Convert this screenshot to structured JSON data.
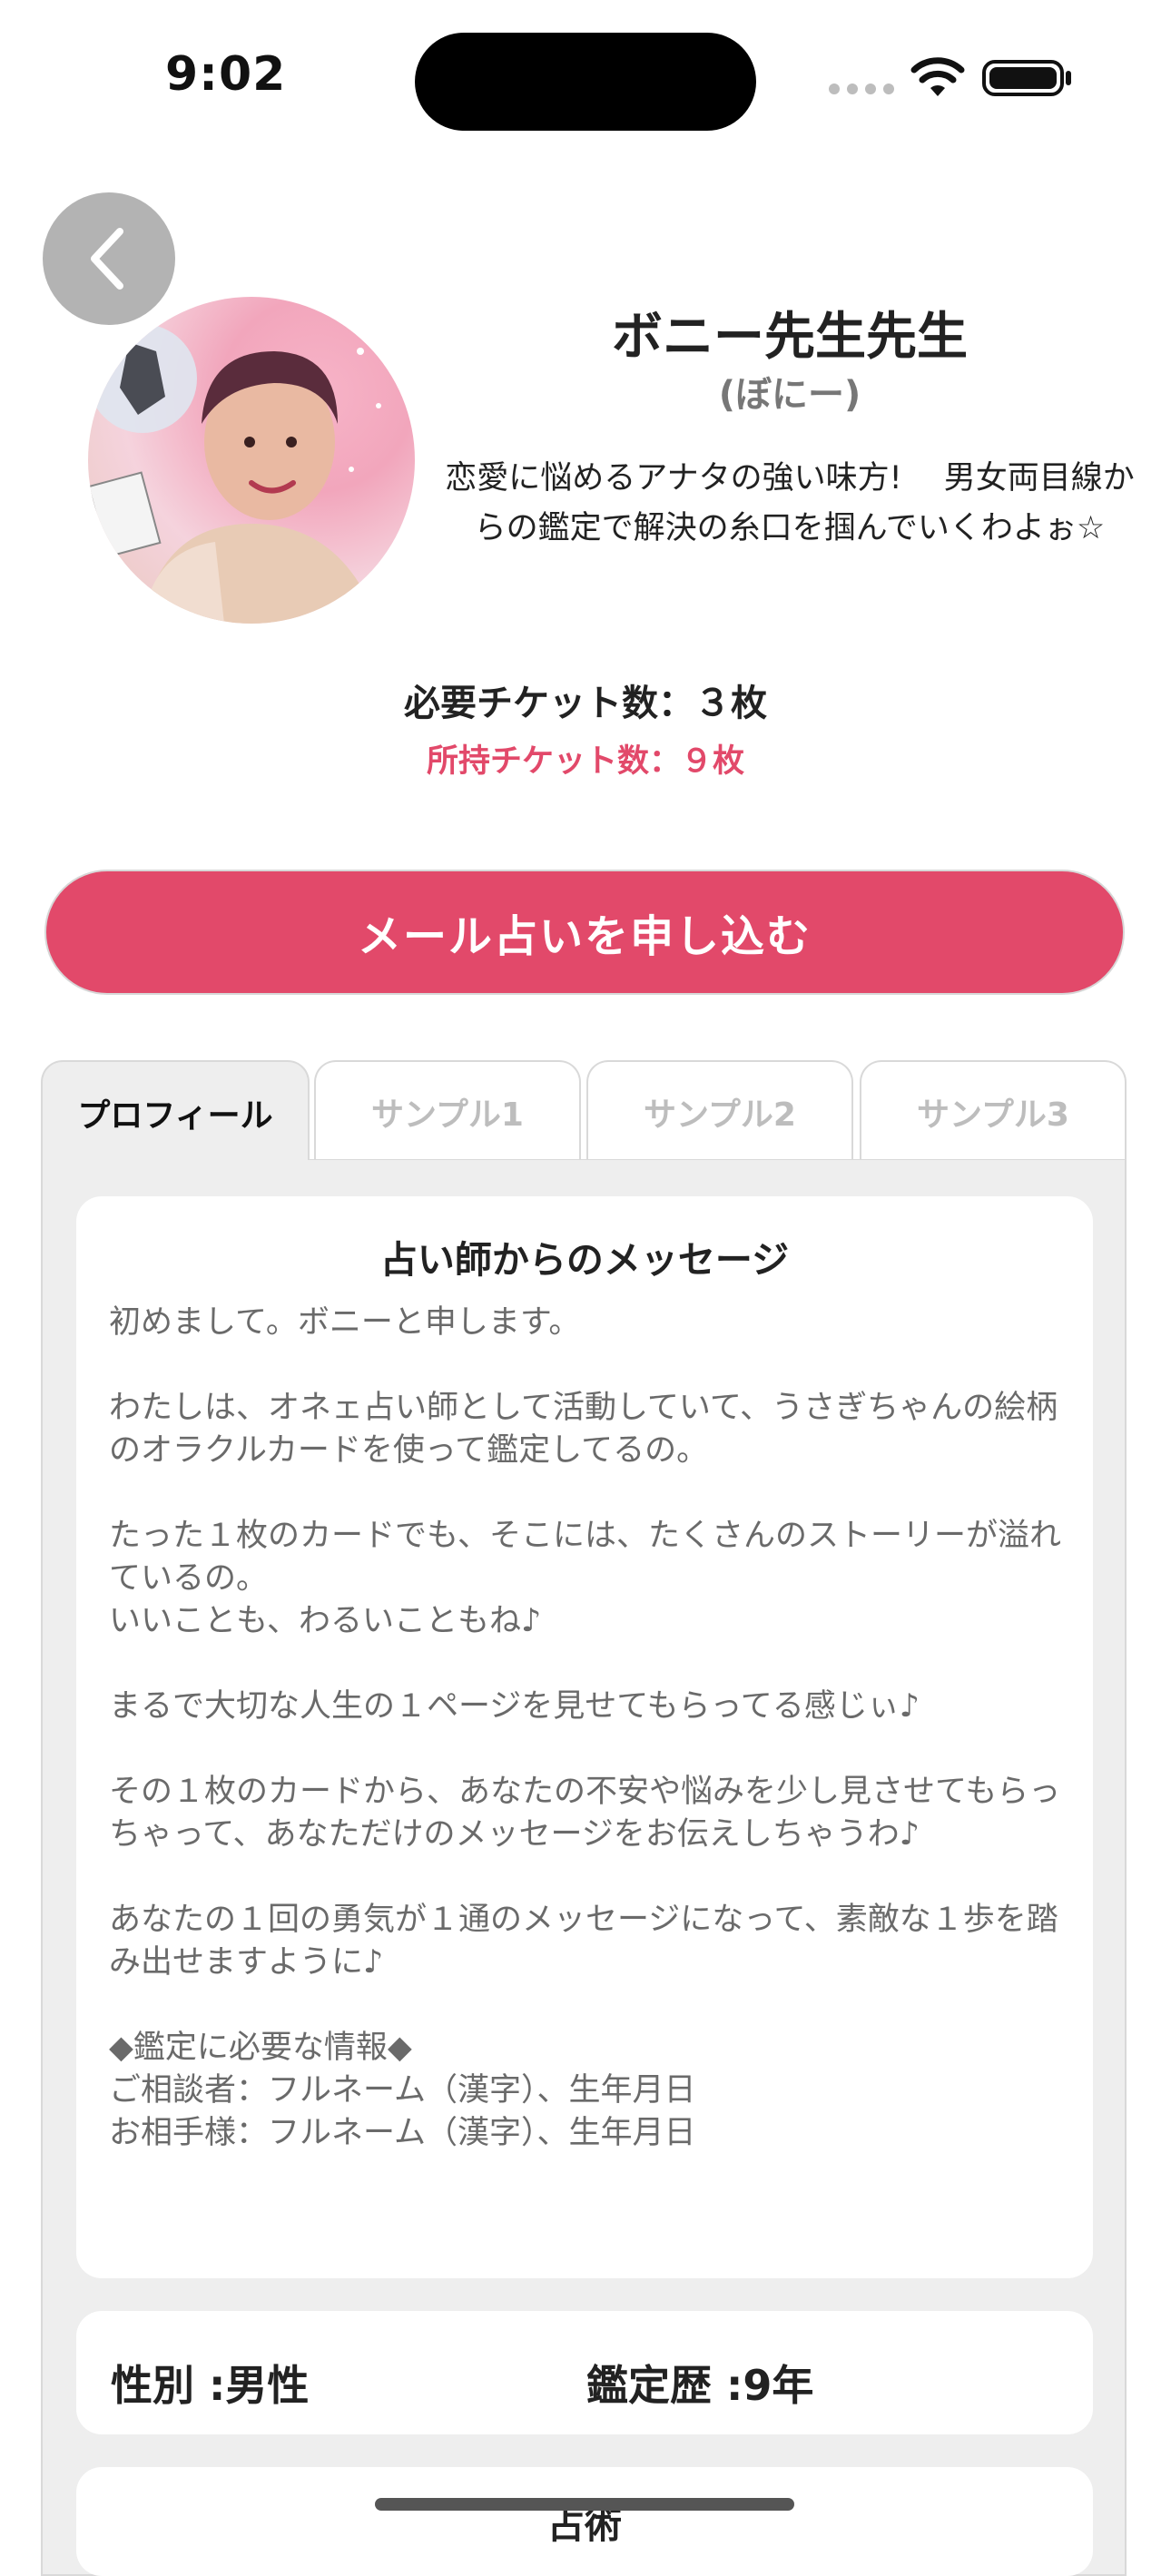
{
  "status": {
    "time": "9:02"
  },
  "profile": {
    "name": "ボニー先生先生",
    "kana": "(ぼにー)",
    "catchphrase": "恋愛に悩めるアナタの強い味方!　 男女両目線からの鑑定で解決の糸口を掴んでいくわよぉ☆"
  },
  "tickets": {
    "required": "必要チケット数：３枚",
    "owned": "所持チケット数：９枚"
  },
  "apply_button": "メール占いを申し込む",
  "tabs": [
    {
      "label": "プロフィール"
    },
    {
      "label": "サンプル1"
    },
    {
      "label": "サンプル2"
    },
    {
      "label": "サンプル3"
    }
  ],
  "message": {
    "title": "占い師からのメッセージ",
    "body": "初めまして。ボニーと申します。\n\nわたしは、オネェ占い師として活動していて、うさぎちゃんの絵柄のオラクルカードを使って鑑定してるの。\n\nたった１枚のカードでも、そこには、たくさんのストーリーが溢れているの。\nいいことも、わるいこともね♪\n\nまるで大切な人生の１ページを見せてもらってる感じぃ♪\n\nその１枚のカードから、あなたの不安や悩みを少し見させてもらっちゃって、あなただけのメッセージをお伝えしちゃうわ♪\n\nあなたの１回の勇気が１通のメッセージになって、素敵な１歩を踏み出せますように♪\n\n◆鑑定に必要な情報◆\nご相談者：フルネーム（漢字）、生年月日\nお相手様：フルネーム（漢字）、生年月日"
  },
  "info": {
    "gender": "性別 :男性",
    "experience": "鑑定歴 :9年"
  },
  "methods": {
    "title": "占術"
  },
  "colors": {
    "accent": "#e2496a",
    "panel_bg": "#eeeeee"
  },
  "icons": {
    "back": "chevron-left-icon"
  }
}
